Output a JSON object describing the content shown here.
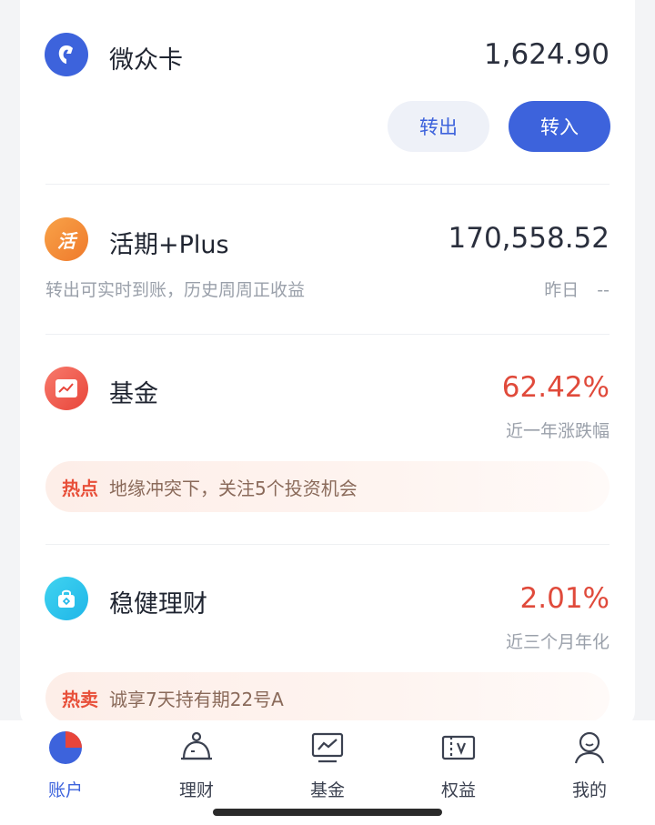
{
  "colors": {
    "accent": "#3d63dc",
    "red": "#e04a3b",
    "orange": "#f38b3c"
  },
  "weizhong": {
    "title": "微众卡",
    "amount": "1,624.90",
    "transfer_out": "转出",
    "transfer_in": "转入",
    "icon": "wechat-bank-icon"
  },
  "huoqi": {
    "title": "活期+Plus",
    "amount": "170,558.52",
    "desc": "转出可实时到账，历史周周正收益",
    "yesterday_label": "昨日",
    "yesterday_value": "--",
    "icon_glyph": "活"
  },
  "fund": {
    "title": "基金",
    "rate": "62.42%",
    "rate_label": "近一年涨跌幅",
    "hot_tag": "热点",
    "hot_text": "地缘冲突下，关注5个投资机会",
    "icon": "chart-icon"
  },
  "wenjian": {
    "title": "稳健理财",
    "rate": "2.01%",
    "rate_label": "近三个月年化",
    "hot_tag": "热卖",
    "hot_text": "诚享7天持有期22号A",
    "icon": "bag-icon"
  },
  "tabs": [
    {
      "label": "账户",
      "icon": "pie-chart-icon",
      "active": true
    },
    {
      "label": "理财",
      "icon": "piggy-bank-icon",
      "active": false
    },
    {
      "label": "基金",
      "icon": "monitor-chart-icon",
      "active": false
    },
    {
      "label": "权益",
      "icon": "ticket-icon",
      "active": false
    },
    {
      "label": "我的",
      "icon": "person-icon",
      "active": false
    }
  ]
}
